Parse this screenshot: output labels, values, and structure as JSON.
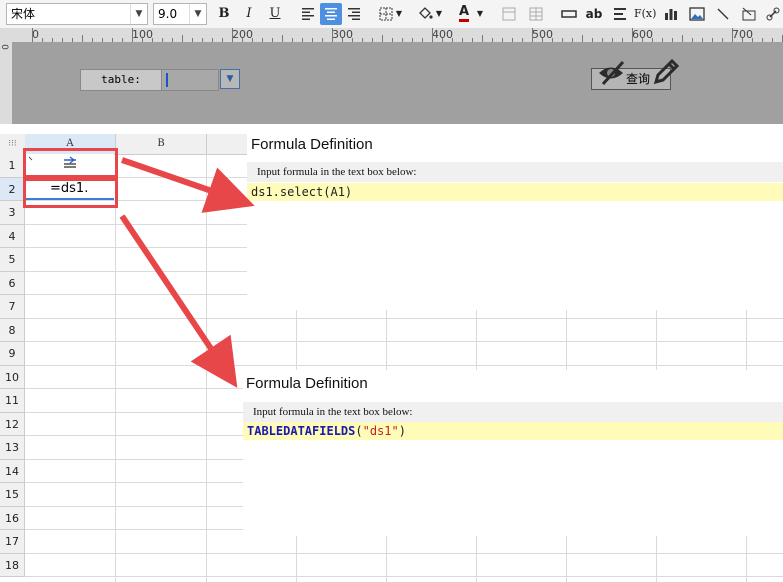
{
  "toolbar": {
    "font_name": "宋体",
    "font_size": "9.0",
    "bold": "B",
    "italic": "I",
    "underline": "U",
    "text_ab": "ab",
    "fx": "F(x)"
  },
  "ruler": {
    "marks": [
      "0",
      "100",
      "200",
      "300",
      "400",
      "500",
      "600",
      "700"
    ],
    "left_mark": "0"
  },
  "form": {
    "table_label": "table:",
    "query_button": "查询"
  },
  "grid": {
    "columns": [
      "A",
      "B"
    ],
    "rows": [
      "1",
      "2",
      "3",
      "4",
      "5",
      "6",
      "7",
      "8",
      "9",
      "10",
      "11",
      "12",
      "13",
      "14",
      "15",
      "16",
      "17",
      "18"
    ],
    "a2_value": "=ds1."
  },
  "panel1": {
    "title": "Formula Definition",
    "subtitle": "Input formula in the text box below:",
    "code": "ds1.select(A1)"
  },
  "panel2": {
    "title": "Formula Definition",
    "subtitle": "Input formula in the text box below:",
    "code_fn": "TABLEDATAFIELDS",
    "code_open": "(",
    "code_arg": "\"ds1\"",
    "code_close": ")"
  },
  "colors": {
    "highlight_red": "#e8474a",
    "code_bg": "#fffbb8",
    "accent_blue": "#3b7fd4"
  }
}
